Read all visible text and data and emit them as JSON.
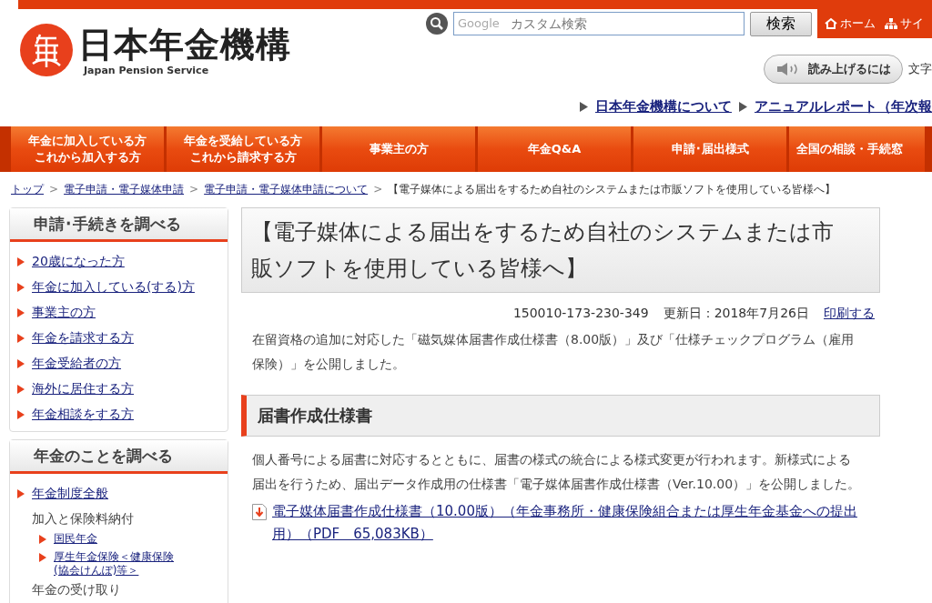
{
  "header": {
    "logo": {
      "name": "日本年金機構",
      "subtitle": "Japan Pension Service"
    },
    "search": {
      "placeholder": "カスタム検索",
      "brand": "Google",
      "button": "検索"
    },
    "top_links": [
      {
        "kind": "home",
        "label": "ホーム"
      },
      {
        "kind": "sitemap",
        "label": "サイ"
      }
    ],
    "read_button": "読み上げるには",
    "text_size_label": "文字",
    "sub_links": [
      {
        "label": "日本年金機構について"
      },
      {
        "label": "アニュアルレポート（年次報"
      }
    ]
  },
  "nav": [
    {
      "lines": [
        "年金に加入している方",
        "これから加入する方"
      ]
    },
    {
      "lines": [
        "年金を受給している方",
        "これから請求する方"
      ]
    },
    {
      "lines": [
        "事業主の方"
      ]
    },
    {
      "lines": [
        "年金Q&A"
      ]
    },
    {
      "lines": [
        "申請･届出様式"
      ]
    },
    {
      "lines": [
        "全国の相談・手続窓"
      ]
    }
  ],
  "breadcrumb": [
    {
      "kind": "link",
      "label": "トップ",
      "separator": ">"
    },
    {
      "kind": "link",
      "label": "電子申請・電子媒体申請",
      "separator": ">"
    },
    {
      "kind": "link",
      "label": "電子申請・電子媒体申請について",
      "separator": ">"
    },
    {
      "kind": "current",
      "label": "【電子媒体による届出をするため自社のシステムまたは市販ソフトを使用している皆様へ】"
    }
  ],
  "sidebar": [
    {
      "title": "申請･手続きを調べる",
      "items": [
        {
          "kind": "link",
          "label": "20歳になった方"
        },
        {
          "kind": "link",
          "label": "年金に加入している(する)方"
        },
        {
          "kind": "link",
          "label": "事業主の方"
        },
        {
          "kind": "link",
          "label": "年金を請求する方"
        },
        {
          "kind": "link",
          "label": "年金受給者の方"
        },
        {
          "kind": "link",
          "label": "海外に居住する方"
        },
        {
          "kind": "link",
          "label": "年金相談をする方"
        }
      ]
    },
    {
      "title": "年金のことを調べる",
      "items": [
        {
          "kind": "link",
          "label": "年金制度全般"
        },
        {
          "kind": "plain",
          "label": "加入と保険料納付",
          "children": [
            {
              "kind": "link",
              "label": "国民年金"
            },
            {
              "kind": "link",
              "label": "厚生年金保険＜健康保険(協会けんぽ)等＞"
            }
          ]
        },
        {
          "kind": "plain",
          "label": "年金の受け取り"
        }
      ]
    }
  ],
  "main": {
    "title": "【電子媒体による届出をするため自社のシステムまたは市販ソフトを使用している皆様へ】",
    "meta": {
      "id": "150010-173-230-349",
      "updated": "更新日：2018年7月26日",
      "print": "印刷する"
    },
    "intro": "在留資格の追加に対応した「磁気媒体届書作成仕様書（8.00版）」及び「仕様チェックプログラム（雇用保険）」を公開しました。",
    "sections": [
      {
        "heading": "届書作成仕様書",
        "paragraph": "個人番号による届書に対応するとともに、届書の様式の統合による様式変更が行われます。新様式による届出を行うため、届出データ作成用の仕様書「電子媒体届書作成仕様書（Ver.10.00）」を公開しました。",
        "files": [
          {
            "label": "電子媒体届書作成仕様書（10.00版）（年金事務所・健康保険組合または厚生年金基金への提出用）（PDF　65,083KB）"
          }
        ]
      }
    ]
  }
}
